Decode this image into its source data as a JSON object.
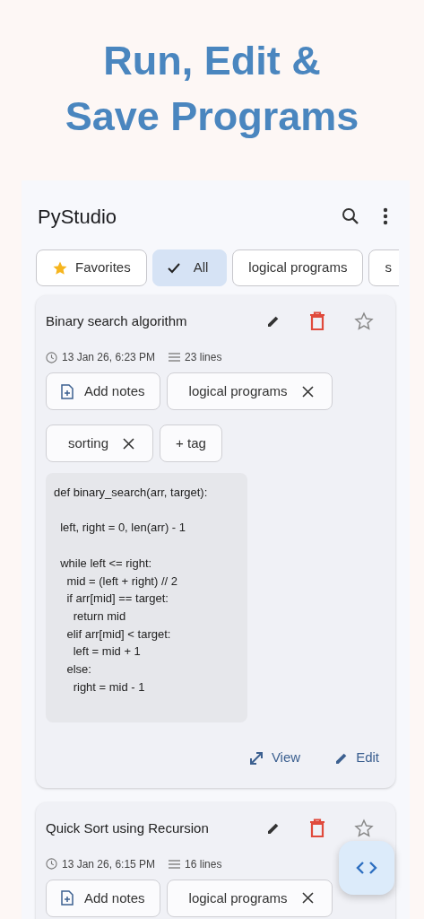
{
  "headline": [
    "Run, Edit &",
    "Save Programs"
  ],
  "app_bar": {
    "title": "PyStudio"
  },
  "filter_chips": [
    {
      "label": "Favorites",
      "kind": "favorites",
      "selected": false
    },
    {
      "label": "All",
      "kind": "plain",
      "selected": true
    },
    {
      "label": "logical programs",
      "kind": "plain",
      "selected": false
    },
    {
      "label": "s",
      "kind": "plain",
      "selected": false
    }
  ],
  "programs": [
    {
      "title": "Binary search algorithm",
      "favorite": false,
      "date": "13 Jan 26, 6:23 PM",
      "lines": "23 lines",
      "notes_button": "Add notes",
      "tags": [
        "logical programs",
        "sorting"
      ],
      "add_tag": "+ tag",
      "code": "def binary_search(arr, target):\n\n  left, right = 0, len(arr) - 1\n\n  while left <= right:\n    mid = (left + right) // 2\n    if arr[mid] == target:\n      return mid\n    elif arr[mid] < target:\n      left = mid + 1\n    else:\n      right = mid - 1\n",
      "actions": [
        "View",
        "Edit"
      ]
    },
    {
      "title": "Quick Sort using Recursion",
      "favorite": false,
      "date": "13 Jan 26, 6:15 PM",
      "lines": "16 lines",
      "notes_button": "Add notes",
      "tags": [
        "logical programs"
      ]
    }
  ]
}
